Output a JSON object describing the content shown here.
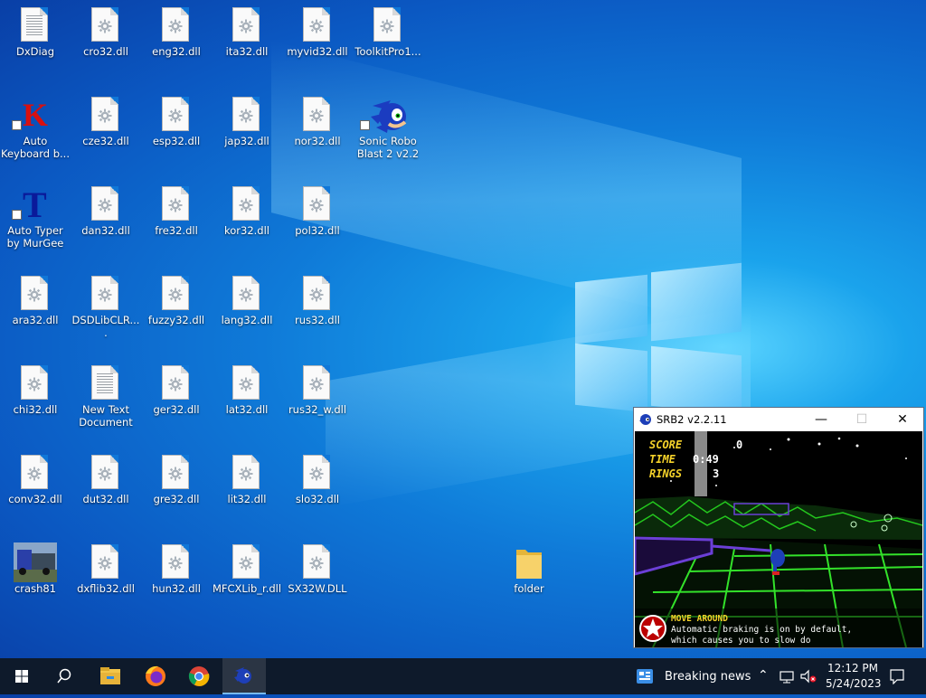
{
  "desktop": {
    "icons": [
      {
        "label": "DxDiag"
      },
      {
        "label": "cro32.dll"
      },
      {
        "label": "eng32.dll"
      },
      {
        "label": "ita32.dll"
      },
      {
        "label": "myvid32.dll"
      },
      {
        "label": "ToolkitPro1..."
      },
      {
        "label": "Auto Keyboard b..."
      },
      {
        "label": "cze32.dll"
      },
      {
        "label": "esp32.dll"
      },
      {
        "label": "jap32.dll"
      },
      {
        "label": "nor32.dll"
      },
      {
        "label": "Sonic Robo Blast 2 v2.2"
      },
      {
        "label": "Auto Typer by MurGee"
      },
      {
        "label": "dan32.dll"
      },
      {
        "label": "fre32.dll"
      },
      {
        "label": "kor32.dll"
      },
      {
        "label": "pol32.dll"
      },
      {
        "label": "ara32.dll"
      },
      {
        "label": "DSDLibCLR...."
      },
      {
        "label": "fuzzy32.dll"
      },
      {
        "label": "lang32.dll"
      },
      {
        "label": "rus32.dll"
      },
      {
        "label": "chi32.dll"
      },
      {
        "label": "New Text Document"
      },
      {
        "label": "ger32.dll"
      },
      {
        "label": "lat32.dll"
      },
      {
        "label": "rus32_w.dll"
      },
      {
        "label": "conv32.dll"
      },
      {
        "label": "dut32.dll"
      },
      {
        "label": "gre32.dll"
      },
      {
        "label": "lit32.dll"
      },
      {
        "label": "slo32.dll"
      },
      {
        "label": "crash81"
      },
      {
        "label": "dxflib32.dll"
      },
      {
        "label": "hun32.dll"
      },
      {
        "label": "MFCXLib_r.dll"
      },
      {
        "label": "SX32W.DLL"
      },
      {
        "label": "folder"
      }
    ]
  },
  "window": {
    "title": "SRB2 v2.2.11",
    "minimize": "—",
    "maximize": "☐",
    "close": "✕",
    "hud": {
      "score_label": "SCORE",
      "score_value": "0",
      "time_label": "TIME",
      "time_value": "0:49",
      "rings_label": "RINGS",
      "rings_value": "3"
    },
    "tip": {
      "title": "MOVE AROUND",
      "line1": "Automatic braking is on by default,",
      "line2": "which causes you to slow do"
    }
  },
  "taskbar": {
    "news": "Breaking news",
    "time": "12:12 PM",
    "date": "5/24/2023",
    "colors": {
      "bar": "#0e1a2b",
      "accent": "#76b9ed"
    }
  }
}
